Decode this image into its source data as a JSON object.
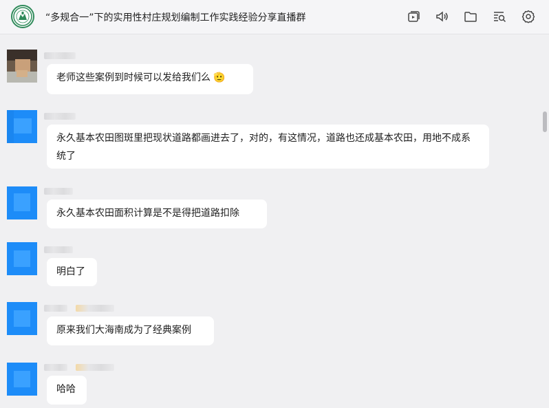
{
  "header": {
    "title": "“多规合一”下的实用性村庄规划编制工作实践经验分享直播群",
    "tools": [
      "live-icon",
      "speaker-icon",
      "folder-icon",
      "search-history-icon",
      "settings-icon"
    ]
  },
  "messages": [
    {
      "text": "老师这些案例到时候可以发给我们么",
      "emoji": "🫡"
    },
    {
      "text": "永久基本农田图斑里把现状道路都画进去了，对的，有这情况，道路也还成基本农田，用地不成系统了"
    },
    {
      "text": "永久基本农田面积计算是不是得把道路扣除"
    },
    {
      "text": "明白了"
    },
    {
      "text": "原来我们大海南成为了经典案例"
    },
    {
      "text": "哈哈"
    }
  ],
  "colors": {
    "accent": "#1d8cf8",
    "bubble": "#ffffff",
    "background": "#f0f0f2"
  }
}
